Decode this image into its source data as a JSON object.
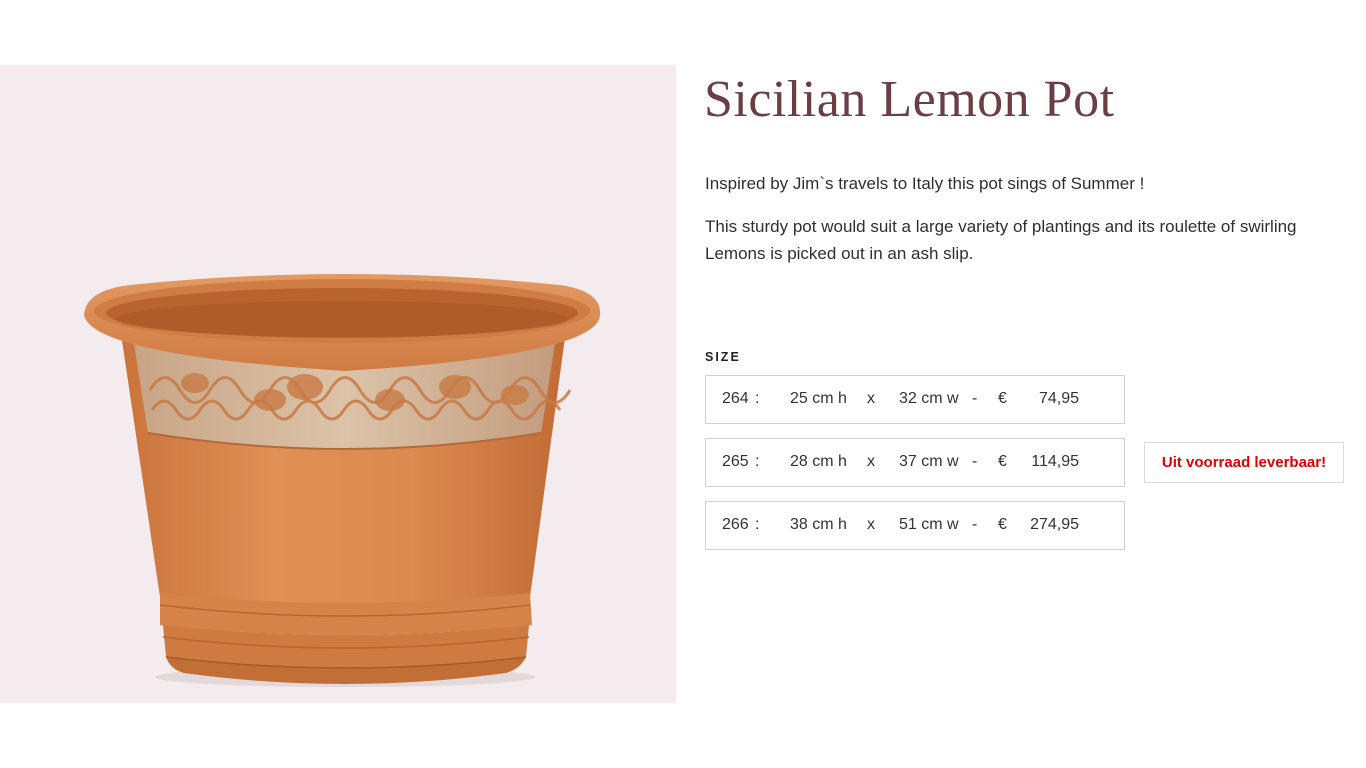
{
  "product": {
    "title": "Sicilian Lemon Pot",
    "description_1": "Inspired by Jim`s travels to Italy this pot sings of Summer !",
    "description_2": "This sturdy pot would suit a large variety of plantings and its roulette of swirling Lemons is picked out in an ash slip.",
    "image_alt": "terracotta-pot-image"
  },
  "size": {
    "label": "SIZE",
    "options": [
      {
        "code": "264",
        "colon": ":",
        "height": "25 cm  h",
        "x": "x",
        "width": "32 cm  w",
        "dash": "-",
        "currency": "€",
        "price": "74,95"
      },
      {
        "code": "265",
        "colon": ":",
        "height": "28 cm  h",
        "x": "x",
        "width": "37 cm  w",
        "dash": "-",
        "currency": "€",
        "price": "114,95"
      },
      {
        "code": "266",
        "colon": ":",
        "height": "38 cm  h",
        "x": "x",
        "width": "51 cm  w",
        "dash": "-",
        "currency": "€",
        "price": "274,95"
      }
    ]
  },
  "stock_badge": {
    "text": "Uit voorraad leverbaar!",
    "color": "#e00000"
  },
  "colors": {
    "title": "#6b3e46",
    "image_background": "#f3ebed",
    "terracotta": "#d9854c"
  }
}
